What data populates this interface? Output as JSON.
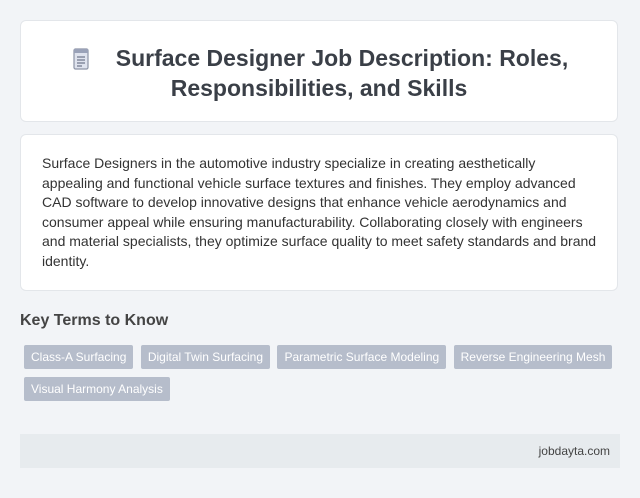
{
  "header": {
    "title": "Surface Designer Job Description: Roles, Responsibilities, and Skills",
    "icon": "document-icon"
  },
  "description": {
    "text": "Surface Designers in the automotive industry specialize in creating aesthetically appealing and functional vehicle surface textures and finishes. They employ advanced CAD software to develop innovative designs that enhance vehicle aerodynamics and consumer appeal while ensuring manufacturability. Collaborating closely with engineers and material specialists, they optimize surface quality to meet safety standards and brand identity."
  },
  "key_terms": {
    "heading": "Key Terms to Know",
    "tags": [
      "Class-A Surfacing",
      "Digital Twin Surfacing",
      "Parametric Surface Modeling",
      "Reverse Engineering Mesh",
      "Visual Harmony Analysis"
    ]
  },
  "footer": {
    "site": "jobdayta.com"
  },
  "colors": {
    "background": "#f2f4f7",
    "tag": "#b6bdcb",
    "footer": "#e7ebee"
  }
}
